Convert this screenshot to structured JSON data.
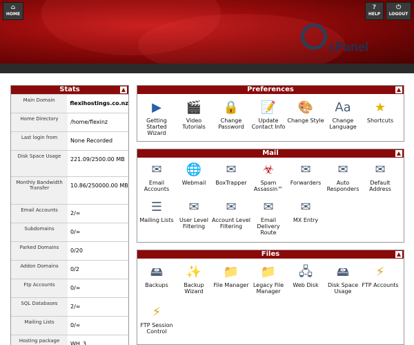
{
  "header": {
    "home_label": "HOME",
    "help_label": "HELP",
    "logout_label": "LOGOUT",
    "logo_text": "cPanel"
  },
  "stats": {
    "title": "Stats",
    "rows": [
      {
        "label": "Main Domain",
        "value": "flexihostings.co.nz"
      },
      {
        "label": "Home Directory",
        "value": "/home/flexinz"
      },
      {
        "label": "Last login from",
        "value": "None Recorded"
      },
      {
        "label": "Disk Space Usage",
        "value": "221.09/2500.00 MB",
        "fill": 0.09
      },
      {
        "label": "Monthly Bandwidth Transfer",
        "value": "10.86/250000.00 MB",
        "fill": 0.0
      },
      {
        "label": "Email Accounts",
        "value": "2/∞",
        "fill": 0.0
      },
      {
        "label": "Subdomains",
        "value": "0/∞",
        "fill": 0.0
      },
      {
        "label": "Parked Domains",
        "value": "0/20",
        "fill": 0.0
      },
      {
        "label": "Addon Domains",
        "value": "0/2",
        "fill": 0.0
      },
      {
        "label": "Ftp Accounts",
        "value": "0/∞",
        "fill": 0.0
      },
      {
        "label": "SQL Databases",
        "value": "2/∞",
        "fill": 0.0
      },
      {
        "label": "Mailing Lists",
        "value": "0/∞",
        "fill": 0.0
      },
      {
        "label": "Hosting package",
        "value": "WH_3"
      }
    ]
  },
  "preferences": {
    "title": "Preferences",
    "items": [
      {
        "label": "Getting Started Wizard",
        "icon": "play-icon"
      },
      {
        "label": "Video Tutorials",
        "icon": "clapper-icon"
      },
      {
        "label": "Change Password",
        "icon": "lock-icon"
      },
      {
        "label": "Update Contact Info",
        "icon": "contact-icon"
      },
      {
        "label": "Change Style",
        "icon": "style-icon"
      },
      {
        "label": "Change Language",
        "icon": "language-icon"
      },
      {
        "label": "Shortcuts",
        "icon": "star-icon"
      }
    ]
  },
  "mail": {
    "title": "Mail",
    "items": [
      {
        "label": "Email Accounts",
        "icon": "envelope-icon"
      },
      {
        "label": "Webmail",
        "icon": "globe-icon"
      },
      {
        "label": "BoxTrapper",
        "icon": "boxtrapper-icon"
      },
      {
        "label": "Spam Assassin™",
        "icon": "spamassassin-icon"
      },
      {
        "label": "Forwarders",
        "icon": "forward-icon"
      },
      {
        "label": "Auto Responders",
        "icon": "autoresponder-icon"
      },
      {
        "label": "Default Address",
        "icon": "default-address-icon"
      },
      {
        "label": "Mailing Lists",
        "icon": "mailing-list-icon"
      },
      {
        "label": "User Level Filtering",
        "icon": "user-filter-icon"
      },
      {
        "label": "Account Level Filtering",
        "icon": "account-filter-icon"
      },
      {
        "label": "Email Delivery Route",
        "icon": "delivery-route-icon"
      },
      {
        "label": "MX Entry",
        "icon": "mx-entry-icon"
      }
    ]
  },
  "files": {
    "title": "Files",
    "items": [
      {
        "label": "Backups",
        "icon": "backup-drive-icon"
      },
      {
        "label": "Backup Wizard",
        "icon": "backup-wizard-icon"
      },
      {
        "label": "File Manager",
        "icon": "folder-icon"
      },
      {
        "label": "Legacy File Manager",
        "icon": "legacy-folder-icon"
      },
      {
        "label": "Web Disk",
        "icon": "web-disk-icon"
      },
      {
        "label": "Disk Space Usage",
        "icon": "disk-usage-icon"
      },
      {
        "label": "FTP Accounts",
        "icon": "ftp-accounts-icon"
      },
      {
        "label": "FTP Session Control",
        "icon": "ftp-session-icon"
      }
    ]
  },
  "colors": {
    "header_red": "#9a0c0c",
    "panel_title": "#8a0a0a",
    "logo_blue": "#1f3350",
    "bar_green": "#2db82d"
  }
}
